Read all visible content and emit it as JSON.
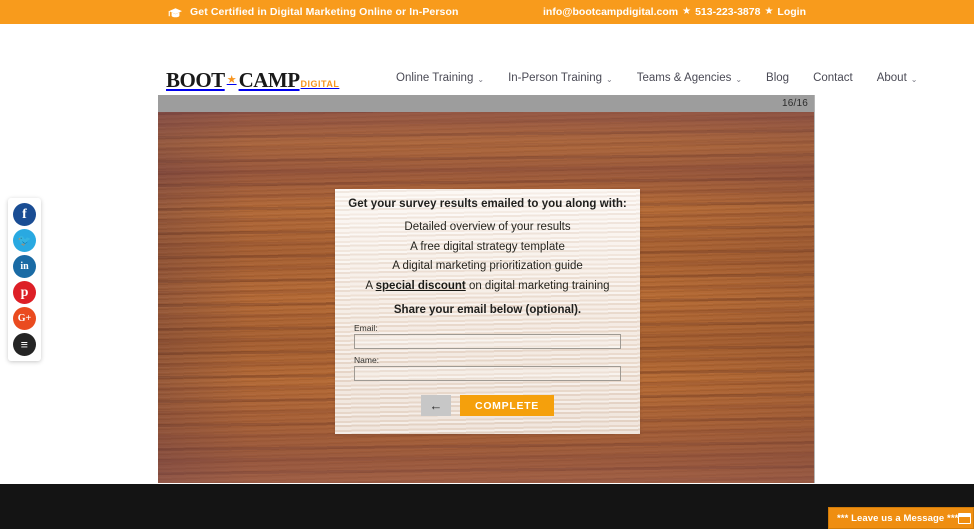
{
  "topbar": {
    "cap_icon": "graduation-cap-icon",
    "tagline": "Get Certified in Digital Marketing Online or In-Person",
    "email": "info@bootcampdigital.com",
    "separator": "★",
    "phone": "513-223-3878",
    "login_label": "Login"
  },
  "logo": {
    "part1": "BOOT",
    "star": "★",
    "part2": "CAMP",
    "suffix": "DIGITAL"
  },
  "nav": {
    "items": [
      {
        "label": "Online Training",
        "caret": "⌄",
        "has_dropdown": true
      },
      {
        "label": "In-Person Training",
        "caret": "⌄",
        "has_dropdown": true
      },
      {
        "label": "Teams & Agencies",
        "caret": "⌄",
        "has_dropdown": true
      },
      {
        "label": "Blog",
        "caret": "",
        "has_dropdown": false
      },
      {
        "label": "Contact",
        "caret": "",
        "has_dropdown": false
      },
      {
        "label": "About",
        "caret": "⌄",
        "has_dropdown": true
      }
    ]
  },
  "social": {
    "items": [
      {
        "name": "facebook-icon",
        "glyph": "f",
        "color": "#1a4d94",
        "size": "14px"
      },
      {
        "name": "twitter-icon",
        "glyph": "🐦",
        "color": "#29a9e1",
        "size": "11px"
      },
      {
        "name": "linkedin-icon",
        "glyph": "in",
        "color": "#1a6ba5",
        "size": "10px"
      },
      {
        "name": "pinterest-icon",
        "glyph": "р",
        "color": "#dd1f26",
        "size": "14px"
      },
      {
        "name": "google-plus-icon",
        "glyph": "G+",
        "color": "#ea4b1f",
        "size": "10px"
      },
      {
        "name": "buffer-icon",
        "glyph": "≡",
        "color": "#252525",
        "size": "13px"
      }
    ]
  },
  "survey": {
    "progress": "16/16",
    "card": {
      "heading": "Get your survey results emailed to you along with:",
      "benefits": [
        {
          "pre": "Detailed overview of your results",
          "highlight": "",
          "post": ""
        },
        {
          "pre": "A free digital strategy template",
          "highlight": "",
          "post": ""
        },
        {
          "pre": "A digital marketing prioritization guide",
          "highlight": "",
          "post": ""
        },
        {
          "pre": "A ",
          "highlight": "special discount",
          "post": " on digital marketing training"
        }
      ],
      "share_heading": "Share your email below (optional).",
      "email_label": "Email:",
      "email_value": "",
      "email_placeholder": "",
      "name_label": "Name:",
      "name_value": "",
      "name_placeholder": "",
      "back_icon": "←",
      "complete_label": "COMPLETE"
    }
  },
  "chat": {
    "label": "*** Leave us a Message ***",
    "window_icon": "chat-window-icon"
  },
  "colors": {
    "brand_orange": "#f89b1c",
    "button_orange": "#f5a00c",
    "chat_orange": "#ef8e11",
    "footer_dark": "#141414",
    "survey_bar_gray": "#9d9d9d"
  }
}
